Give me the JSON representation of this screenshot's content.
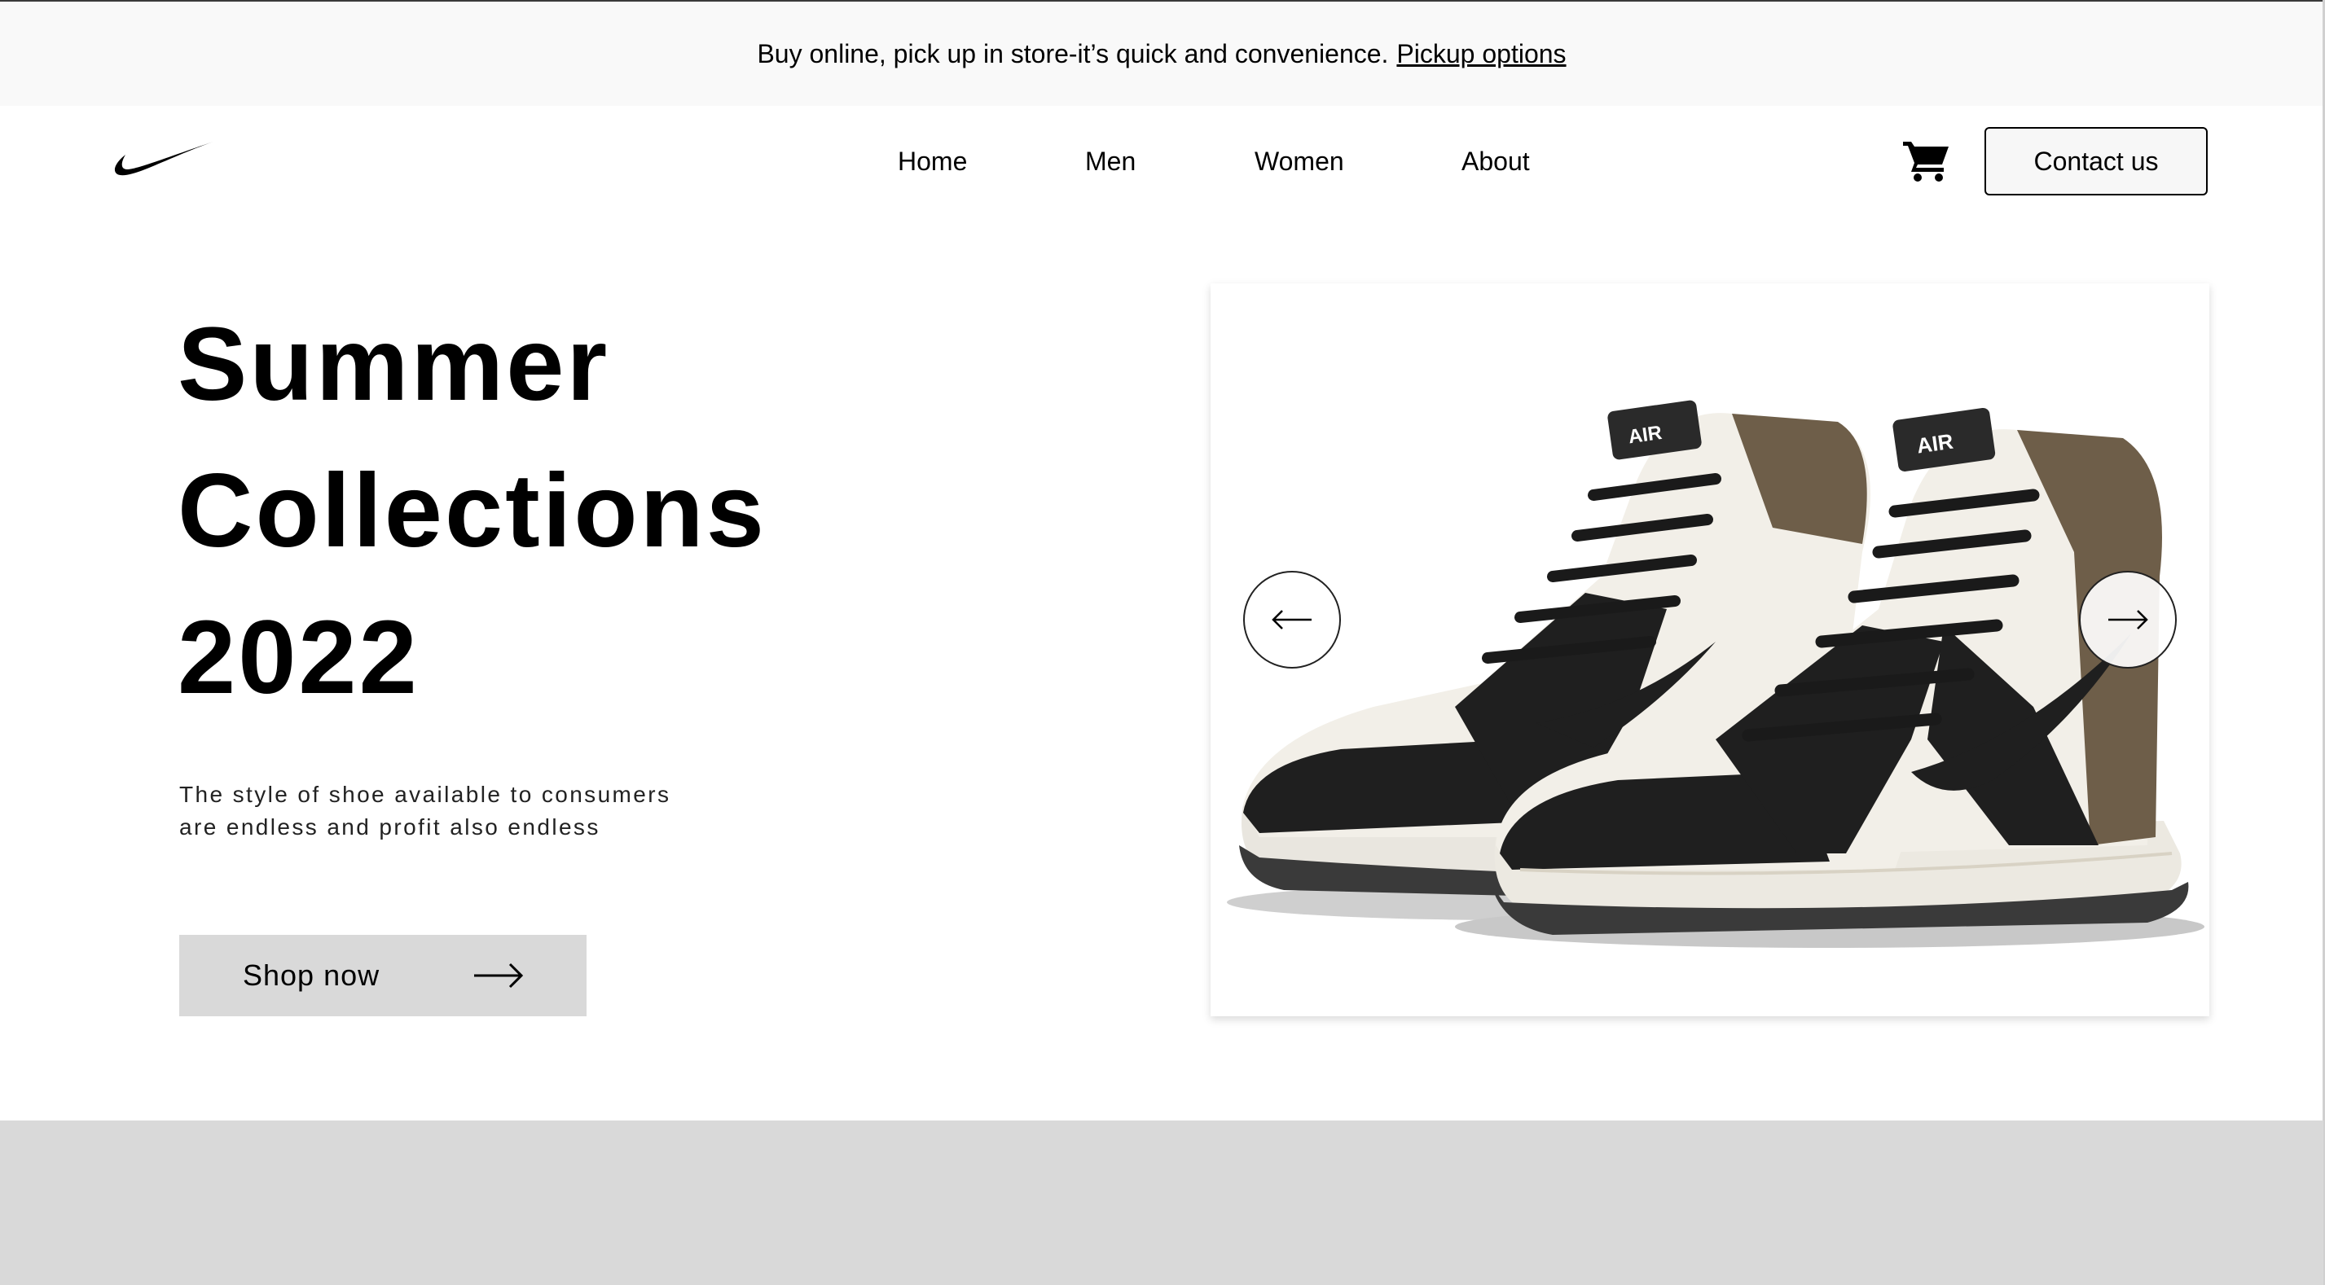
{
  "promo": {
    "text": "Buy online, pick up in store-it’s quick and convenience.",
    "link": "Pickup options"
  },
  "header": {
    "logo_icon": "nike-swoosh-icon",
    "nav": [
      {
        "label": "Home"
      },
      {
        "label": "Men"
      },
      {
        "label": "Women"
      },
      {
        "label": "About"
      }
    ],
    "cart_icon": "cart-icon",
    "contact_label": "Contact us"
  },
  "hero": {
    "title_lines": [
      "Summer",
      "Collections",
      "2022"
    ],
    "subtitle_lines": [
      "The style of shoe available to consumers",
      "are endless and profit also endless"
    ],
    "cta_label": "Shop now",
    "cta_icon": "arrow-right-icon"
  },
  "carousel": {
    "image_alt": "Air Jordan 1 high sneakers",
    "prev_icon": "arrow-left-icon",
    "next_icon": "arrow-right-icon"
  },
  "colors": {
    "promo_bg": "#f9f9f9",
    "button_bg": "#d9d9d9",
    "band_bg": "#d9d9d9",
    "shoe_brown": "#6e5e49",
    "shoe_black": "#1f1f1f",
    "shoe_white": "#f2efe8"
  }
}
